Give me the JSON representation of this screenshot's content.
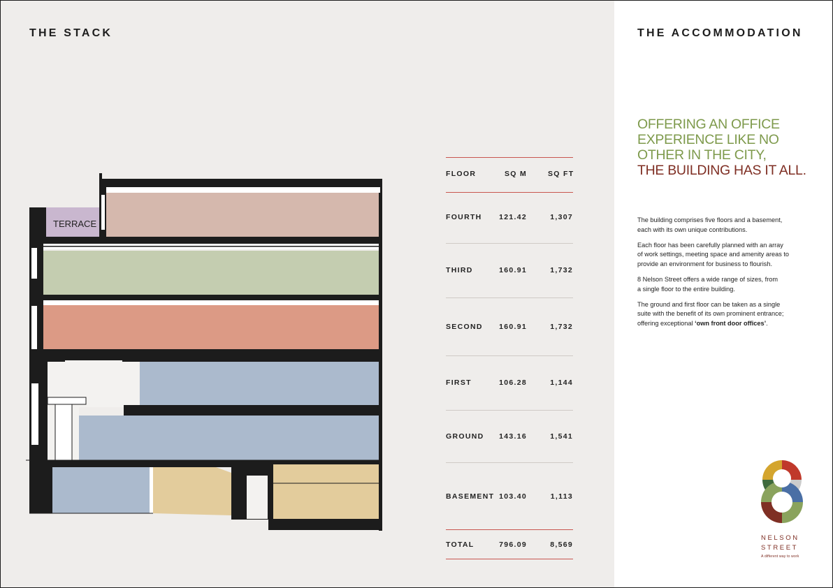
{
  "left_heading": "THE STACK",
  "right_heading": "THE ACCOMMODATION",
  "section": {
    "terrace_label": "TERRACE",
    "colors": {
      "fourth": "#d5b8ad",
      "third": "#c4cdb0",
      "second": "#dc9a85",
      "first": "#abbacd",
      "ground": "#abbacd",
      "basement_blue": "#abbacd",
      "basement_tan": "#e3cc9c",
      "terrace": "#c9b7cf",
      "structure": "#1c1c1c"
    }
  },
  "table": {
    "headers": {
      "floor": "FLOOR",
      "sqm": "SQ M",
      "sqft": "SQ FT"
    },
    "rows": [
      {
        "floor": "FOURTH",
        "sqm": "121.42",
        "sqft": "1,307"
      },
      {
        "floor": "THIRD",
        "sqm": "160.91",
        "sqft": "1,732"
      },
      {
        "floor": "SECOND",
        "sqm": "160.91",
        "sqft": "1,732"
      },
      {
        "floor": "FIRST",
        "sqm": "106.28",
        "sqft": "1,144"
      },
      {
        "floor": "GROUND",
        "sqm": "143.16",
        "sqft": "1,541"
      },
      {
        "floor": "BASEMENT",
        "sqm": "103.40",
        "sqft": "1,113"
      }
    ],
    "total": {
      "floor": "TOTAL",
      "sqm": "796.09",
      "sqft": "8,569"
    },
    "rule_color": "#c8564f"
  },
  "tagline": {
    "line1": "OFFERING AN OFFICE",
    "line2": "EXPERIENCE LIKE NO",
    "line3": "OTHER IN THE CITY,",
    "line4": "THE BUILDING HAS IT ALL.",
    "green": "#7e9a4c",
    "red": "#7f2f24"
  },
  "body": {
    "p1_l1": "The building comprises five floors and a basement,",
    "p1_l2": "each with its own unique contributions.",
    "p2_l1": "Each floor has been carefully planned with an array",
    "p2_l2": "of work settings, meeting space and amenity areas to",
    "p2_l3": "provide an environment for business to flourish.",
    "p3_l1": "8 Nelson Street offers a wide range of sizes, from",
    "p3_l2": "a single floor to the entire building.",
    "p4_l1": "The ground and first floor can be taken as a single",
    "p4_l2": "suite with the benefit of its own prominent entrance;",
    "p4_l3_pre": "offering exceptional ",
    "p4_l3_bold": "‘own front door offices’",
    "p4_l3_post": "."
  },
  "brand": {
    "numeral_icon": "figure-eight-logo-icon",
    "line1": "NELSON",
    "line2": "STREET",
    "strap": "A different way to work",
    "logo_colors": [
      "#c0392b",
      "#d4a52e",
      "#3f6a3c",
      "#4a6fa5",
      "#7f2f24",
      "#8aa35d",
      "#cccccc"
    ]
  }
}
